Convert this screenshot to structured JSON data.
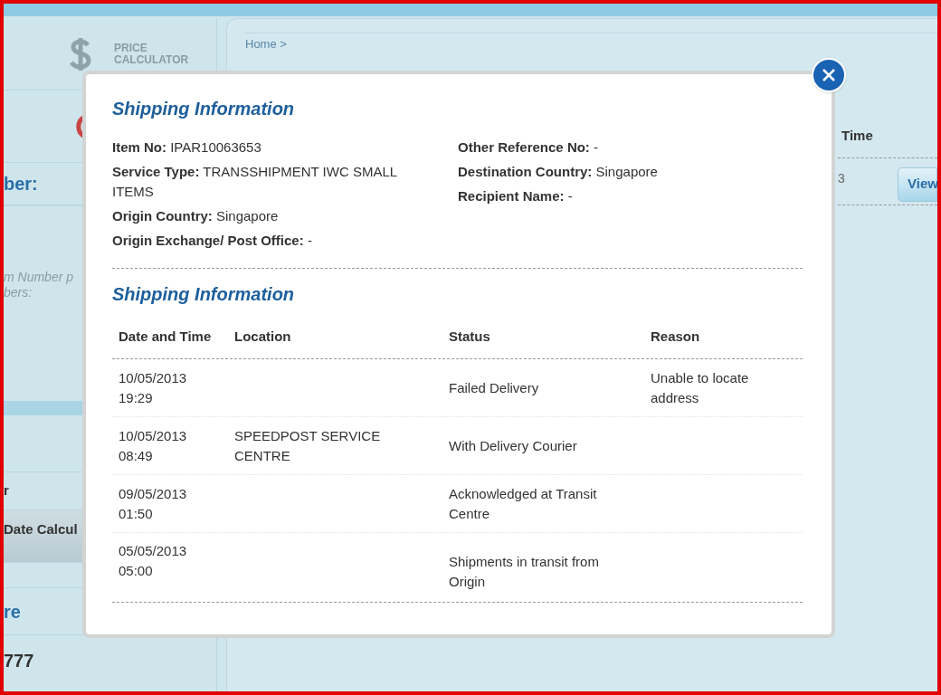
{
  "sidebar": {
    "price_calculator": "PRICE CALCULATOR",
    "field_label": "ber:",
    "hint_lines": [
      "m Number p",
      "bers:"
    ],
    "items": [
      {
        "label": "r",
        "selected": false
      },
      {
        "label": "Date Calcul",
        "selected": true
      }
    ],
    "contact_title": "re",
    "phone": "777"
  },
  "main": {
    "breadcrumb": "Home >",
    "column": "Time",
    "cell": "3",
    "button": "View"
  },
  "modal": {
    "title": "Shipping Information",
    "left_fields": [
      "**Item No:** IPAR10063653",
      "**Service Type:** TRANSSHIPMENT IWC SMALL ITEMS",
      "**Origin Country:** Singapore",
      "**Origin Exchange/ Post Office:** -"
    ],
    "right_fields": [
      "**Other Reference No:** -",
      "**Destination Country:** Singapore",
      "**Recipient Name:** -"
    ],
    "history_title": "Shipping Information",
    "columns": [
      "Date and Time",
      "Location",
      "Status",
      "Reason"
    ],
    "rows": [
      {
        "date": "10/05/2013",
        "time": "19:29",
        "status": "Failed Delivery",
        "reason": "Unable to locate address"
      },
      {
        "date": "10/05/2013",
        "time": "08:49",
        "location": "SPEEDPOST SERVICE CENTRE",
        "status": "With Delivery Courier"
      },
      {
        "date": "09/05/2013",
        "time": "01:50",
        "status": "Acknowledged at Transit Centre"
      },
      {
        "date": "05/05/2013",
        "time": "05:00",
        "status": "Shipments in transit from Origin"
      }
    ]
  }
}
